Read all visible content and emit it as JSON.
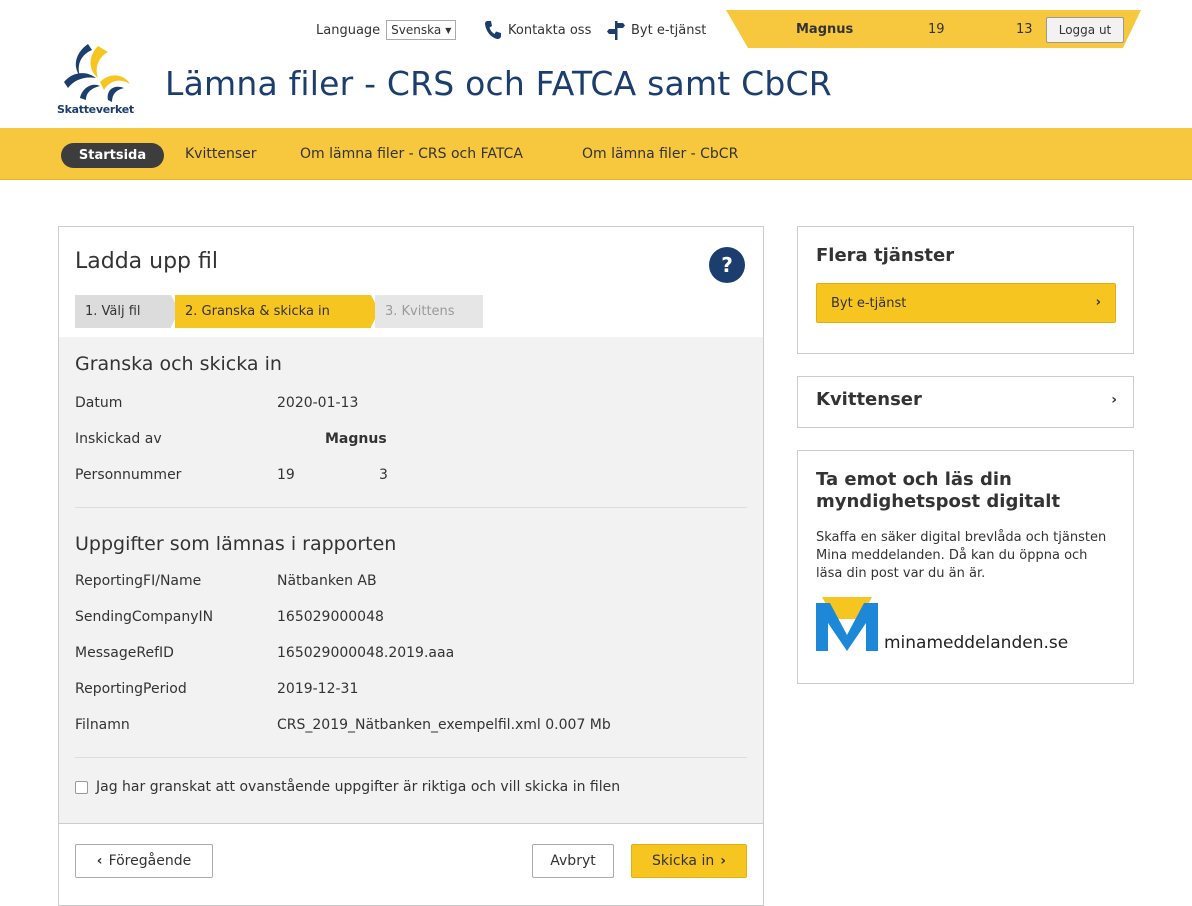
{
  "topbar": {
    "language_label": "Language",
    "language_value": "Svenska",
    "contact_label": "Kontakta oss",
    "switch_service_label": "Byt e-tjänst",
    "user_name": "Magnus",
    "user_num1": "19",
    "user_num2": "13",
    "logout_label": "Logga ut"
  },
  "header": {
    "logo_text": "Skatteverket",
    "title": "Lämna filer - CRS och FATCA samt CbCR"
  },
  "nav": {
    "items": [
      "Startsida",
      "Kvittenser",
      "Om lämna filer - CRS och FATCA",
      "Om lämna filer - CbCR"
    ]
  },
  "main": {
    "title": "Ladda upp fil",
    "help_label": "?",
    "steps": [
      "1.  Välj fil",
      "2. Granska & skicka in",
      "3. Kvittens"
    ],
    "review_title": "Granska och skicka in",
    "review_rows": [
      {
        "label": "Datum",
        "value": "2020-01-13"
      },
      {
        "label": "Inskickad av",
        "value": "Magnus"
      },
      {
        "label": "Personnummer",
        "value": "19",
        "value2": "3"
      }
    ],
    "report_title": "Uppgifter som lämnas i rapporten",
    "report_rows": [
      {
        "label": "ReportingFI/Name",
        "value": "Nätbanken AB"
      },
      {
        "label": "SendingCompanyIN",
        "value": "165029000048"
      },
      {
        "label": "MessageRefID",
        "value": "165029000048.2019.aaa"
      },
      {
        "label": "ReportingPeriod",
        "value": "2019-12-31"
      },
      {
        "label": "Filnamn",
        "value": "CRS_2019_Nätbanken_exempelfil.xml  0.007 Mb"
      }
    ],
    "confirm_label": "Jag har granskat att ovanstående uppgifter är riktiga och vill skicka in filen",
    "prev_label": "Föregående",
    "cancel_label": "Avbryt",
    "submit_label": "Skicka in"
  },
  "sidebar": {
    "more_services_title": "Flera tjänster",
    "switch_service_btn": "Byt e-tjänst",
    "receipts_title": "Kvittenser",
    "digital_title": "Ta emot och läs din myndighetspost digitalt",
    "digital_text": "Skaffa en säker digital brevlåda och tjänsten Mina meddelanden. Då kan du öppna och läsa din post var du än är.",
    "mm_logo_text": "minameddelanden.se"
  },
  "colors": {
    "brand_blue": "#1b3e6f",
    "accent_yellow": "#f7c520",
    "nav_yellow": "#f7c83e"
  }
}
